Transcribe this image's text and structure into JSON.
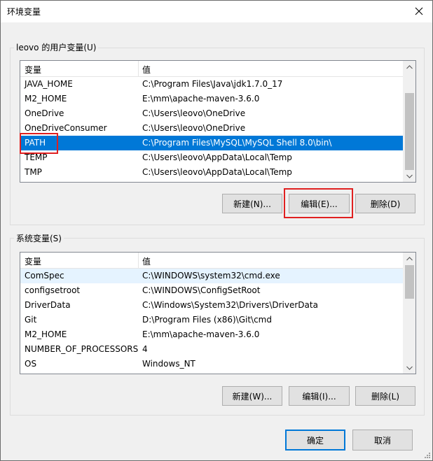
{
  "window": {
    "title": "环境变量"
  },
  "user_vars": {
    "label": "leovo 的用户变量(U)",
    "headers": [
      "变量",
      "值"
    ],
    "rows": [
      {
        "name": "JAVA_HOME",
        "value": "C:\\Program Files\\Java\\jdk1.7.0_17"
      },
      {
        "name": "M2_HOME",
        "value": "E:\\mm\\apache-maven-3.6.0"
      },
      {
        "name": "OneDrive",
        "value": "C:\\Users\\leovo\\OneDrive"
      },
      {
        "name": "OneDriveConsumer",
        "value": "C:\\Users\\leovo\\OneDrive"
      },
      {
        "name": "PATH",
        "value": "C:\\Program Files\\MySQL\\MySQL Shell 8.0\\bin\\"
      },
      {
        "name": "TEMP",
        "value": "C:\\Users\\leovo\\AppData\\Local\\Temp"
      },
      {
        "name": "TMP",
        "value": "C:\\Users\\leovo\\AppData\\Local\\Temp"
      }
    ],
    "selected_index": 4,
    "buttons": {
      "new": "新建(N)...",
      "edit": "编辑(E)...",
      "delete": "删除(D)"
    }
  },
  "system_vars": {
    "label": "系统变量(S)",
    "headers": [
      "变量",
      "值"
    ],
    "rows": [
      {
        "name": "ComSpec",
        "value": "C:\\WINDOWS\\system32\\cmd.exe"
      },
      {
        "name": "configsetroot",
        "value": "C:\\WINDOWS\\ConfigSetRoot"
      },
      {
        "name": "DriverData",
        "value": "C:\\Windows\\System32\\Drivers\\DriverData"
      },
      {
        "name": "Git",
        "value": "D:\\Program Files (x86)\\Git\\cmd"
      },
      {
        "name": "M2_HOME",
        "value": "E:\\mm\\apache-maven-3.6.0"
      },
      {
        "name": "NUMBER_OF_PROCESSORS",
        "value": "4"
      },
      {
        "name": "OS",
        "value": "Windows_NT"
      }
    ],
    "hover_index": 0,
    "buttons": {
      "new": "新建(W)...",
      "edit": "编辑(I)...",
      "delete": "删除(L)"
    }
  },
  "footer": {
    "ok": "确定",
    "cancel": "取消"
  },
  "colors": {
    "selection": "#0078d7",
    "annotation": "#e02020",
    "hover": "#e5f3ff"
  }
}
